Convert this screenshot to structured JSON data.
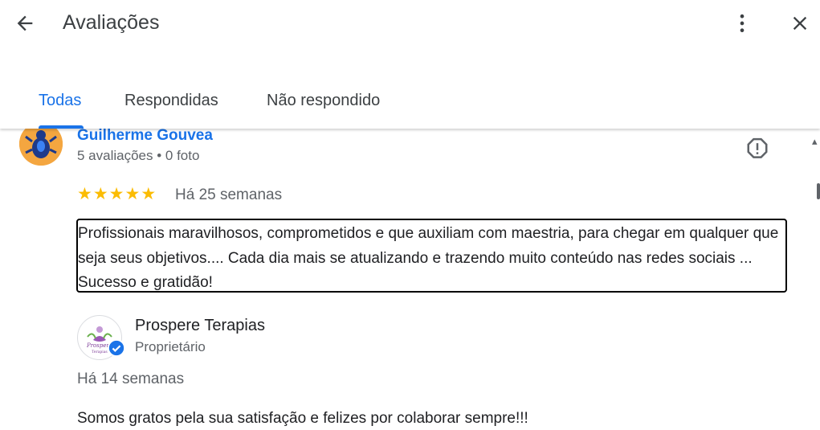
{
  "header": {
    "title": "Avaliações",
    "back_icon": "arrow-back-icon",
    "more_icon": "more-vert-icon",
    "close_icon": "close-icon"
  },
  "tabs": [
    {
      "label": "Todas",
      "active": true
    },
    {
      "label": "Respondidas",
      "active": false
    },
    {
      "label": "Não respondido",
      "active": false
    }
  ],
  "review": {
    "reviewer_name": "Guilherme Gouvea",
    "reviewer_meta": "5 avaliações • 0 foto",
    "rating": 5,
    "time": "Há 25 semanas",
    "text": "Profissionais maravilhosos, comprometidos e que auxiliam com maestria, para chegar em qualquer que seja seus objetivos.... Cada dia mais se atualizando e trazendo muito conteúdo nas redes sociais ... Sucesso e gratidão!",
    "report_icon": "report-icon"
  },
  "owner_reply": {
    "name": "Prospere Terapias",
    "role": "Proprietário",
    "time": "Há 14 semanas",
    "text": "Somos gratos pela sua satisfação e felizes por colaborar sempre!!!",
    "logo_text": "Prospere",
    "logo_subtext": "Terapias"
  },
  "colors": {
    "accent": "#1a73e8",
    "star": "#fbbc04",
    "secondary_text": "#5f6368"
  }
}
